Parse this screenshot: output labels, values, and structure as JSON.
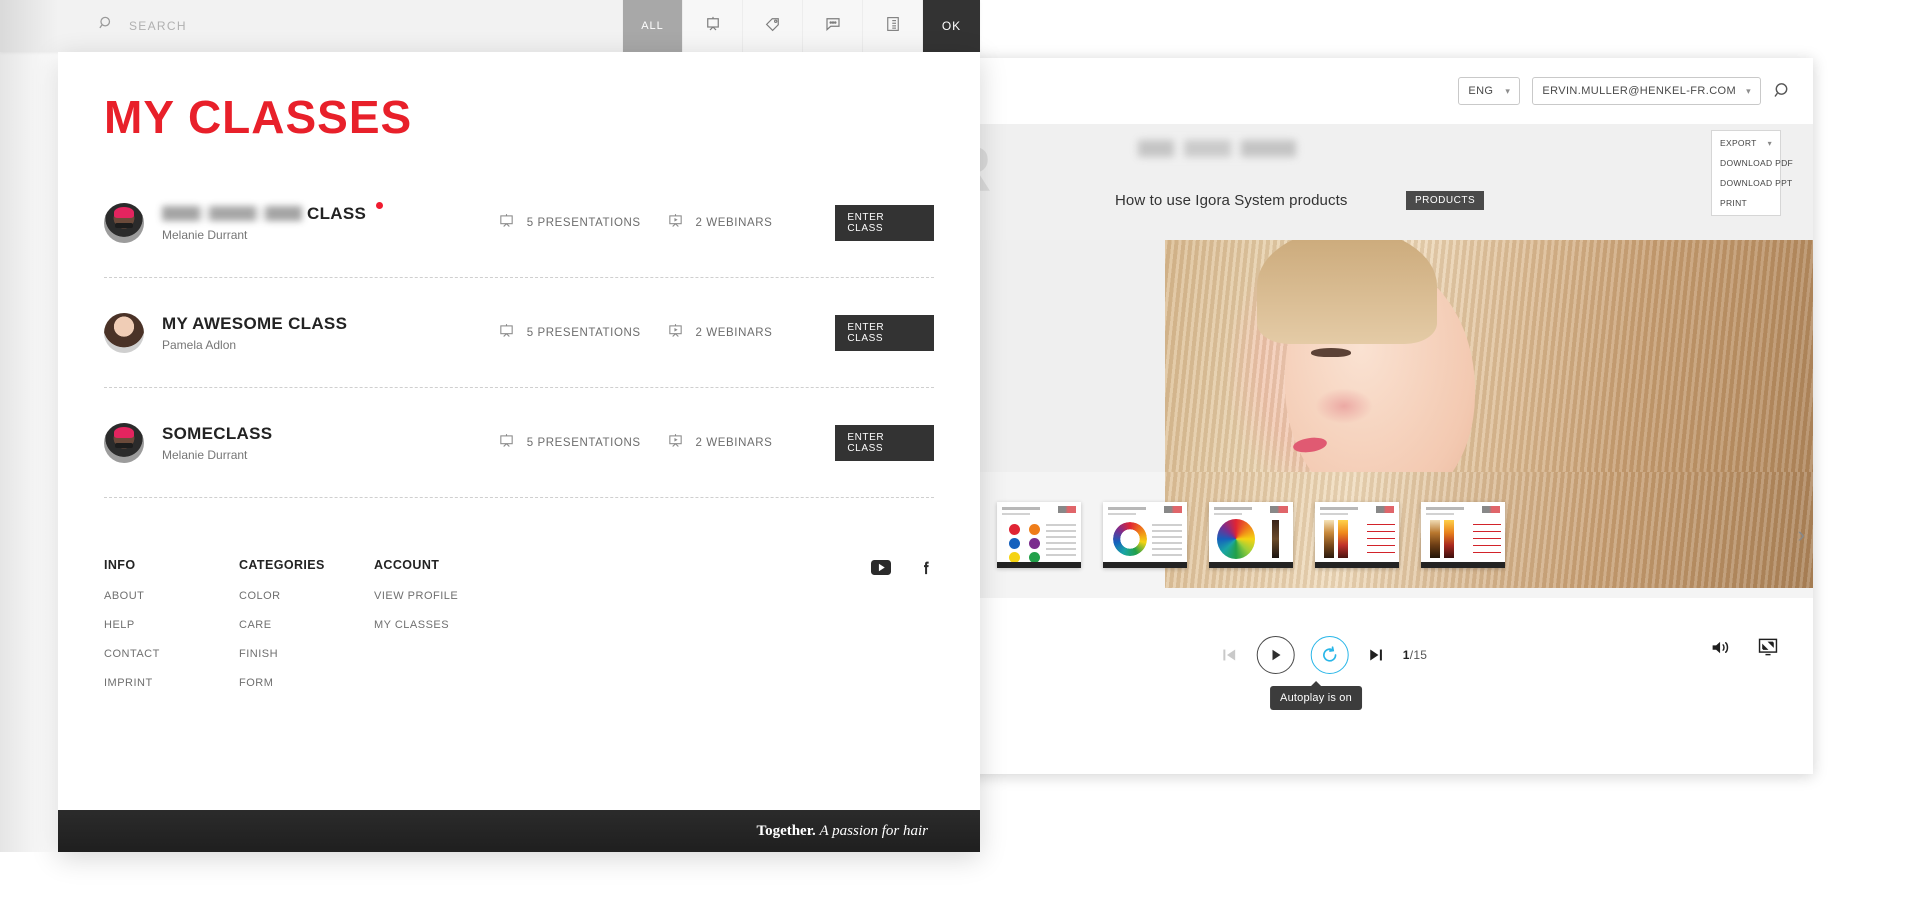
{
  "overlay": {
    "search": {
      "placeholder": "SEARCH",
      "value": "",
      "icon": "search-icon"
    },
    "filters": [
      {
        "label": "ALL",
        "icon": "all-label",
        "active": true
      },
      {
        "label": "",
        "icon": "presentation-icon",
        "active": false
      },
      {
        "label": "",
        "icon": "tag-icon",
        "active": false
      },
      {
        "label": "",
        "icon": "chat-bubble-icon",
        "active": false
      },
      {
        "label": "",
        "icon": "list-icon",
        "active": false
      }
    ],
    "ok_label": "OK",
    "title": "MY CLASSES",
    "accent_color": "#e8202a",
    "classes": [
      {
        "name_redacted": true,
        "name_suffix": "CLASS",
        "has_new_badge": true,
        "teacher": "Melanie Durrant",
        "presentations": "5 PRESENTATIONS",
        "webinars": "2 WEBINARS",
        "enter_label": "ENTER CLASS"
      },
      {
        "name_redacted": false,
        "name": "MY AWESOME CLASS",
        "name_suffix": "",
        "has_new_badge": false,
        "teacher": "Pamela Adlon",
        "presentations": "5 PRESENTATIONS",
        "webinars": "2 WEBINARS",
        "enter_label": "ENTER CLASS"
      },
      {
        "name_redacted": false,
        "name": "SOMECLASS",
        "name_suffix": "",
        "has_new_badge": false,
        "teacher": "Melanie Durrant",
        "presentations": "5 PRESENTATIONS",
        "webinars": "2 WEBINARS",
        "enter_label": "ENTER CLASS"
      }
    ],
    "footer": {
      "columns": [
        {
          "heading": "INFO",
          "links": [
            "ABOUT",
            "HELP",
            "CONTACT",
            "IMPRINT"
          ]
        },
        {
          "heading": "CATEGORIES",
          "links": [
            "COLOR",
            "CARE",
            "FINISH",
            "FORM"
          ]
        },
        {
          "heading": "ACCOUNT",
          "links": [
            "VIEW PROFILE",
            "MY CLASSES"
          ]
        }
      ],
      "social": [
        "youtube-icon",
        "facebook-icon"
      ],
      "tagline_bold": "Together.",
      "tagline_italic": "A passion for hair"
    }
  },
  "app": {
    "language": "ENG",
    "account_email": "ERVIN.MULLER@HENKEL-FR.COM",
    "search_icon": "search-icon",
    "slide": {
      "watermark": "OUR",
      "title_redacted": true,
      "subtitle": "How to use Igora System products",
      "badge": "PRODUCTS"
    },
    "export_menu": {
      "label": "EXPORT",
      "items": [
        "DOWNLOAD PDF",
        "DOWNLOAD PPT",
        "PRINT"
      ]
    },
    "player": {
      "prev_label": "previous-slide",
      "play_label": "play",
      "autoplay_label": "autoplay",
      "next_label": "next-slide",
      "page_current": "1",
      "page_total": "/15",
      "tooltip": "Autoplay is on",
      "volume_label": "volume",
      "fullscreen_label": "fullscreen",
      "autoplay_color": "#29b6e8"
    },
    "filmstrip": {
      "next_arrow": "›",
      "thumbnails": [
        {
          "kind": "text"
        },
        {
          "kind": "primary-colours"
        },
        {
          "kind": "secondary-colours"
        },
        {
          "kind": "colour-circle"
        },
        {
          "kind": "colour-wheel"
        },
        {
          "kind": "pigments-a"
        },
        {
          "kind": "pigments-b"
        }
      ]
    }
  }
}
